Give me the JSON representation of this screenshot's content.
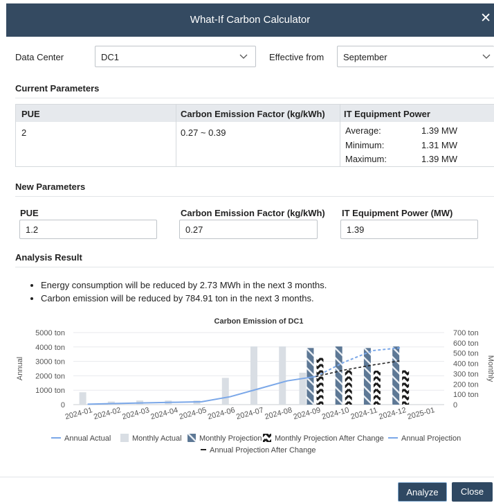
{
  "dialog": {
    "title": "What-If Carbon Calculator",
    "close_glyph": "✕"
  },
  "filters": {
    "data_center_label": "Data Center",
    "data_center_value": "DC1",
    "effective_label": "Effective from",
    "effective_value": "September"
  },
  "current": {
    "title": "Current Parameters",
    "headers": [
      "PUE",
      "Carbon Emission Factor (kg/kWh)",
      "IT Equipment Power"
    ],
    "pue": "2",
    "factor": "0.27 ~ 0.39",
    "power": [
      {
        "label": "Average:",
        "value": "1.39 MW"
      },
      {
        "label": "Minimum:",
        "value": "1.31 MW"
      },
      {
        "label": "Maximum:",
        "value": "1.39 MW"
      }
    ]
  },
  "new_params": {
    "title": "New Parameters",
    "pue_label": "PUE",
    "pue_value": "1.2",
    "factor_label": "Carbon Emission Factor (kg/kWh)",
    "factor_value": "0.27",
    "power_label": "IT Equipment Power (MW)",
    "power_value": "1.39"
  },
  "analysis": {
    "title": "Analysis Result",
    "bullets": [
      "Energy consumption will be reduced by 2.73 MWh in the next 3 months.",
      "Carbon emission will be reduced by 784.91 ton in the next 3 months."
    ]
  },
  "chart_data": {
    "type": "bar",
    "title": "Carbon Emission of  DC1",
    "categories": [
      "2024-01",
      "2024-02",
      "2024-03",
      "2024-04",
      "2024-05",
      "2024-06",
      "2024-07",
      "2024-08",
      "2024-09",
      "2024-10",
      "2024-11",
      "2024-12",
      "2025-01"
    ],
    "ylabel_left": "Annual",
    "ylabel_right": "Monthly",
    "y_left_ticks": [
      "0",
      "1000 ton",
      "2000 ton",
      "3000 ton",
      "4000 ton",
      "5000 ton"
    ],
    "y_right_ticks": [
      "0",
      "100 ton",
      "200 ton",
      "300 ton",
      "400 ton",
      "500 ton",
      "600 ton",
      "700 ton"
    ],
    "ylim_left": [
      0,
      5000
    ],
    "ylim_right": [
      0,
      700
    ],
    "series": [
      {
        "name": "Annual Actual",
        "axis": "left",
        "kind": "line",
        "values": [
          30,
          80,
          120,
          160,
          200,
          550,
          1100,
          1650,
          1950,
          null,
          null,
          null,
          null
        ]
      },
      {
        "name": "Monthly Actual",
        "axis": "right",
        "kind": "bar",
        "values": [
          120,
          30,
          40,
          40,
          40,
          260,
          565,
          565,
          310,
          null,
          null,
          null,
          null
        ]
      },
      {
        "name": "Monthly Projection",
        "axis": "right",
        "kind": "bar",
        "values": [
          null,
          null,
          null,
          null,
          null,
          null,
          null,
          null,
          550,
          565,
          550,
          565,
          null
        ]
      },
      {
        "name": "Monthly Projection After Change",
        "axis": "right",
        "kind": "bar",
        "values": [
          null,
          null,
          null,
          null,
          null,
          null,
          null,
          null,
          455,
          335,
          330,
          335,
          null
        ]
      },
      {
        "name": "Annual Projection",
        "axis": "left",
        "kind": "dashed",
        "values": [
          null,
          null,
          null,
          null,
          null,
          null,
          null,
          null,
          1950,
          2950,
          3750,
          3950,
          null
        ]
      },
      {
        "name": "Annual Projection After Change",
        "axis": "left",
        "kind": "dashed",
        "values": [
          null,
          null,
          null,
          null,
          null,
          null,
          null,
          null,
          1950,
          2400,
          2750,
          3050,
          null
        ]
      }
    ],
    "legend": [
      "Annual Actual",
      "Monthly Actual",
      "Monthly Projection",
      "Monthly Projection After Change",
      "Annual Projection",
      "Annual Projection After Change"
    ],
    "legend_position": "bottom",
    "colors": {
      "annual_actual": "#7aa7e8",
      "monthly_actual": "#d9dee4",
      "monthly_projection": "#5d7895",
      "after_change": "#1a1a1a",
      "annual_projection": "#7aa7e8",
      "annual_after": "#222222",
      "grid": "#e8eaed"
    }
  },
  "buttons": {
    "analyze": "Analyze",
    "close": "Close"
  }
}
